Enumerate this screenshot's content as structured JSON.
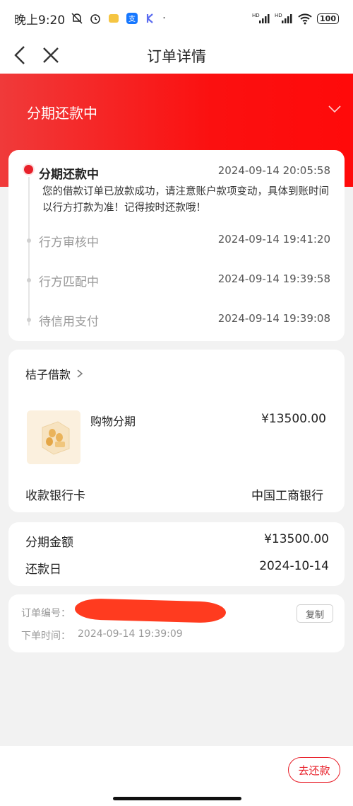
{
  "status_bar": {
    "time": "晚上9:20",
    "battery": "100",
    "hd_label": "HD"
  },
  "nav": {
    "title": "订单详情"
  },
  "banner": {
    "title": "分期还款中"
  },
  "timeline": {
    "active": {
      "title": "分期还款中",
      "time": "2024-09-14 20:05:58",
      "description": "您的借款订单已放款成功，请注意账户款项变动，具体到账时间以行方打款为准！记得按时还款哦！"
    },
    "steps": [
      {
        "title": "行方审核中",
        "time": "2024-09-14 19:41:20"
      },
      {
        "title": "行方匹配中",
        "time": "2024-09-14 19:39:58"
      },
      {
        "title": "待信用支付",
        "time": "2024-09-14 19:39:08"
      }
    ]
  },
  "product": {
    "merchant": "桔子借款",
    "name": "购物分期",
    "price": "¥13500.00",
    "bank_label": "收款银行卡",
    "bank_value": "中国工商银行"
  },
  "amounts": [
    {
      "label": "分期金额",
      "value": "¥13500.00"
    },
    {
      "label": "还款日",
      "value": "2024-10-14"
    }
  ],
  "order": {
    "number_label": "订单编号：",
    "time_label": "下单时间：",
    "time_value": "2024-09-14 19:39:09",
    "copy_label": "复制"
  },
  "bottom": {
    "pay_label": "去还款"
  },
  "colors": {
    "accent": "#e8202a",
    "banner": "#fb1010"
  }
}
